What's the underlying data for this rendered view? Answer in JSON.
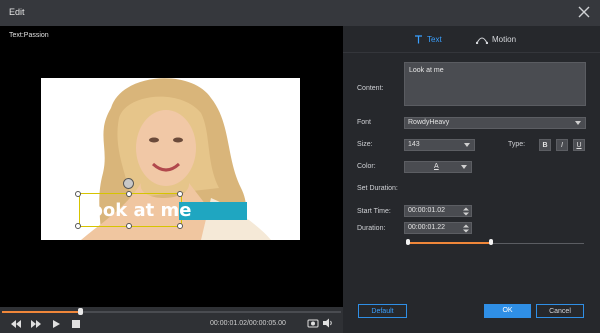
{
  "window": {
    "title": "Edit"
  },
  "preview": {
    "text_tag": "Text:Passion",
    "caption_text": "Look at me",
    "time_display": "00:00:01.02/00:00:05.00",
    "progress_fraction": 0.23
  },
  "panel": {
    "tabs": [
      {
        "label": "Text",
        "active": true
      },
      {
        "label": "Motion",
        "active": false
      }
    ],
    "content_label": "Content:",
    "content_value": "Look at me",
    "font_label": "Font",
    "font_value": "RowdyHeavy",
    "size_label": "Size:",
    "size_value": "143",
    "type_label": "Type:",
    "type_buttons": [
      "B",
      "I",
      "U"
    ],
    "color_label": "Color:",
    "color_value": "A",
    "set_duration_label": "Set Duration:",
    "start_time_label": "Start Time:",
    "start_time_value": "00:00:01.02",
    "duration_label": "Duration:",
    "duration_value": "00:00:01.22",
    "range_start_fraction": 0.01,
    "range_end_fraction": 0.48
  },
  "footer": {
    "default_label": "Default",
    "ok_label": "OK",
    "cancel_label": "Cancel"
  },
  "colors": {
    "accent": "#2f8fe6",
    "progress": "#f0873a",
    "caption_bg": "#1fa6c1"
  }
}
